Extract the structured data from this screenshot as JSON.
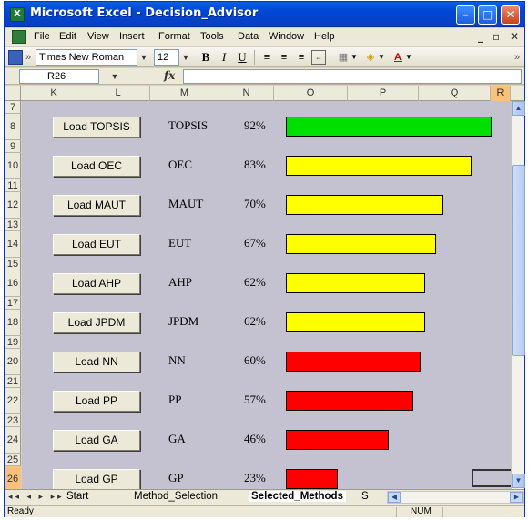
{
  "window": {
    "title": "Microsoft Excel - Decision_Advisor",
    "app_icon": "excel-icon"
  },
  "menu": [
    "File",
    "Edit",
    "View",
    "Insert",
    "Format",
    "Tools",
    "Data",
    "Window",
    "Help"
  ],
  "toolbar": {
    "font_name": "Times New Roman",
    "font_size": "12",
    "bold": "B",
    "italic": "I",
    "underline": "U"
  },
  "formula_bar": {
    "name_box": "R26",
    "fx_label": "fx",
    "formula": ""
  },
  "columns": [
    "K",
    "L",
    "M",
    "N",
    "O",
    "P",
    "Q",
    "R"
  ],
  "selected_column": "R",
  "rows": [
    "7",
    "8",
    "9",
    "10",
    "11",
    "12",
    "13",
    "14",
    "15",
    "16",
    "17",
    "18",
    "19",
    "20",
    "21",
    "22",
    "23",
    "24",
    "25",
    "26"
  ],
  "selected_row": "26",
  "colors": {
    "green": "#00e000",
    "yellow": "#ffff00",
    "red": "#ff0000",
    "sheet_background": "#c4c1d0"
  },
  "methods": [
    {
      "button": "Load TOPSIS",
      "name": "TOPSIS",
      "pct": "92%",
      "value": 92,
      "color": "green"
    },
    {
      "button": "Load OEC",
      "name": "OEC",
      "pct": "83%",
      "value": 83,
      "color": "yellow"
    },
    {
      "button": "Load MAUT",
      "name": "MAUT",
      "pct": "70%",
      "value": 70,
      "color": "yellow"
    },
    {
      "button": "Load EUT",
      "name": "EUT",
      "pct": "67%",
      "value": 67,
      "color": "yellow"
    },
    {
      "button": "Load AHP",
      "name": "AHP",
      "pct": "62%",
      "value": 62,
      "color": "yellow"
    },
    {
      "button": "Load JPDM",
      "name": "JPDM",
      "pct": "62%",
      "value": 62,
      "color": "yellow"
    },
    {
      "button": "Load NN",
      "name": "NN",
      "pct": "60%",
      "value": 60,
      "color": "red"
    },
    {
      "button": "Load PP",
      "name": "PP",
      "pct": "57%",
      "value": 57,
      "color": "red"
    },
    {
      "button": "Load GA",
      "name": "GA",
      "pct": "46%",
      "value": 46,
      "color": "red"
    },
    {
      "button": "Load GP",
      "name": "GP",
      "pct": "23%",
      "value": 23,
      "color": "red"
    }
  ],
  "sheet_tabs": [
    "Start",
    "Method_Selection",
    "Selected_Methods",
    "S"
  ],
  "active_tab": "Selected_Methods",
  "status": {
    "ready": "Ready",
    "num": "NUM"
  }
}
